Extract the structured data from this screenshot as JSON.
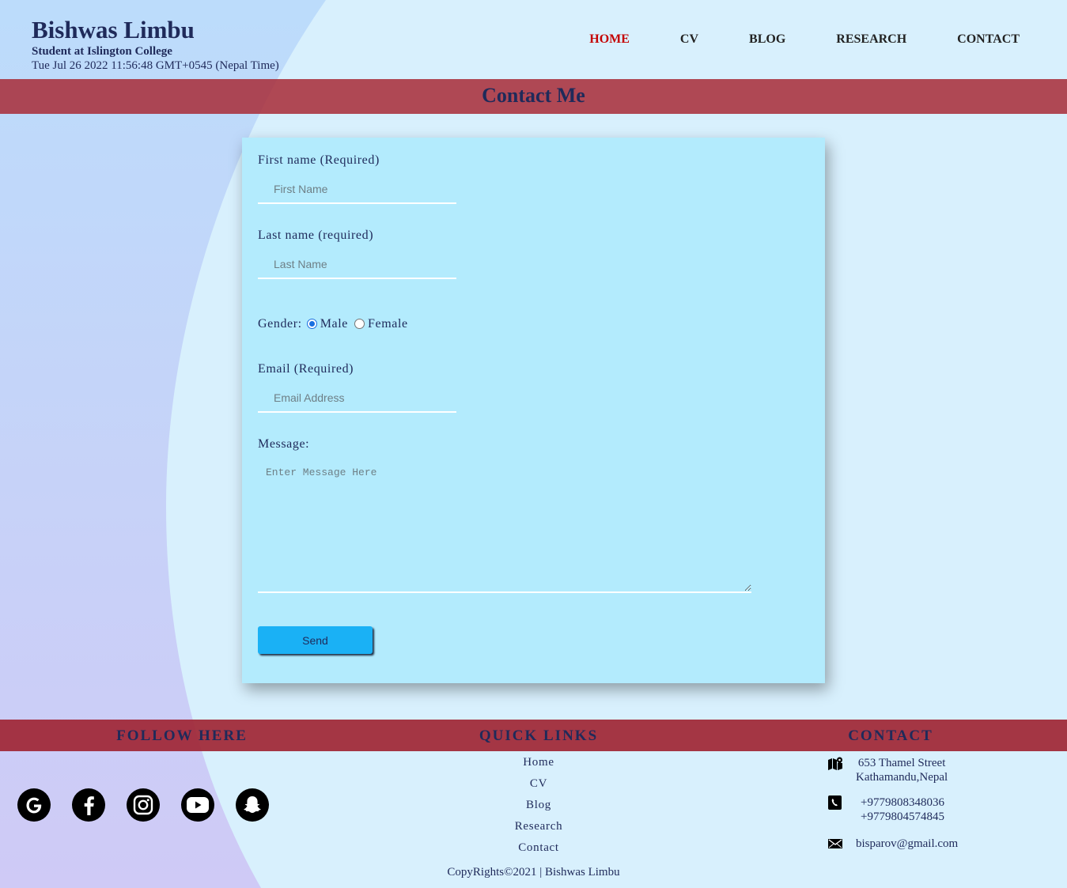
{
  "header": {
    "title": "Bishwas Limbu",
    "subtitle": "Student at Islington College",
    "datetime": "Tue Jul 26 2022 11:56:48 GMT+0545 (Nepal Time)"
  },
  "nav": {
    "items": [
      {
        "label": "HOME",
        "active": true
      },
      {
        "label": "CV"
      },
      {
        "label": "BLOG"
      },
      {
        "label": "RESEARCH"
      },
      {
        "label": "CONTACT"
      }
    ]
  },
  "banner": {
    "title": "Contact Me"
  },
  "form": {
    "first_name_label": "First name (Required)",
    "first_name_placeholder": "First Name",
    "last_name_label": "Last name (required)",
    "last_name_placeholder": "Last Name",
    "gender_label": "Gender:",
    "gender_options": [
      "Male",
      "Female"
    ],
    "gender_selected": "Male",
    "email_label": "Email (Required)",
    "email_placeholder": "Email Address",
    "message_label": "Message:",
    "message_placeholder": "Enter Message Here",
    "send_label": "Send"
  },
  "footer": {
    "follow_heading": "FOLLOW  HERE",
    "quick_links_heading": "QUICK  LINKS",
    "contact_heading": "CONTACT",
    "social_icons": [
      "google-icon",
      "facebook-icon",
      "instagram-icon",
      "youtube-icon",
      "snapchat-icon"
    ],
    "quick_links": [
      "Home",
      "CV",
      "Blog",
      "Research",
      "Contact"
    ],
    "address_line1": "653 Thamel Street",
    "address_line2": "Kathamandu,Nepal",
    "phone1": "+9779808348036",
    "phone2": "+9779804574845",
    "email": "bisparov@gmail.com",
    "copyright": "CopyRights©2021 | Bishwas Limbu"
  },
  "colors": {
    "background": "#d8f0fd",
    "banner": "#a8303c",
    "card": "#b3ebfd",
    "active_nav": "#c40000",
    "send_button": "#1ab1f5"
  }
}
